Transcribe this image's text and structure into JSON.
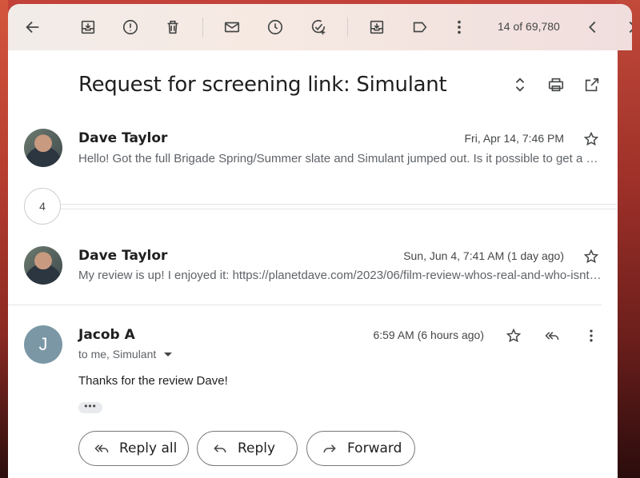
{
  "toolbar": {
    "counter": "14 of 69,780"
  },
  "subject": "Request for screening link: Simulant",
  "collapsed_count": "4",
  "messages": [
    {
      "sender": "Dave Taylor",
      "date": "Fri, Apr 14, 7:46 PM",
      "snippet": "Hello! Got the full Brigade Spring/Summer slate and Simulant jumped out. Is it possible to get a screening link?"
    },
    {
      "sender": "Dave Taylor",
      "date": "Sun, Jun 4, 7:41 AM (1 day ago)",
      "snippet": "My review is up! I enjoyed it: https://planetdave.com/2023/06/film-review-whos-real-and-who-isnt-simulant/"
    },
    {
      "sender": "Jacob A",
      "avatar_letter": "J",
      "date": "6:59 AM (6 hours ago)",
      "to_line": "to me, Simulant",
      "body": "Thanks for the review Dave!"
    }
  ],
  "actions": {
    "reply_all": "Reply all",
    "reply": "Reply",
    "forward": "Forward"
  },
  "colors": {
    "avatar_j": "#7b97a5",
    "toolbar_bg": "#f2ece9"
  }
}
